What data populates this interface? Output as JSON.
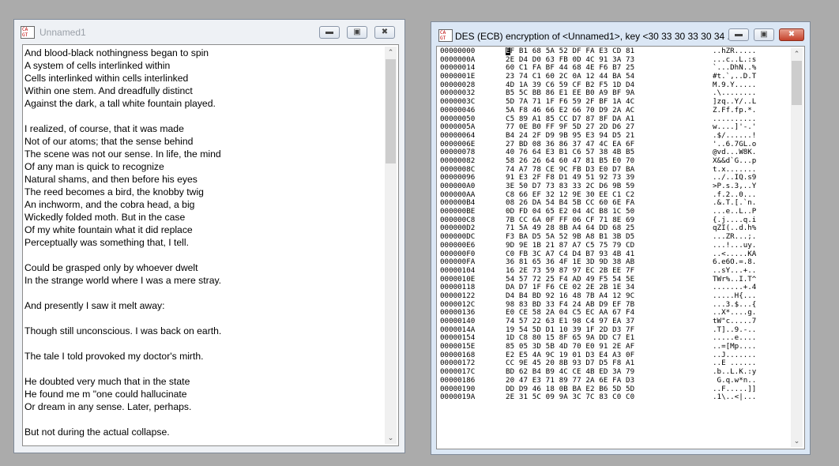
{
  "left_window": {
    "title": "Unnamed1",
    "lines": [
      "And blood-black nothingness began to spin",
      "A system of cells interlinked within",
      "Cells interlinked within cells interlinked",
      "Within one stem. And dreadfully distinct",
      "Against the dark, a tall white fountain played.",
      "",
      "I realized, of course, that it was made",
      "Not of our atoms; that the sense behind",
      "The scene was not our sense. In life, the mind",
      "Of any man is quick to recognize",
      "Natural shams, and then before his eyes",
      "The reed becomes a bird, the knobby twig",
      "An inchworm, and the cobra head, a big",
      "Wickedly folded moth. But in the case",
      "Of my white fountain what it did replace",
      "Perceptually was something that, I tell.",
      "",
      "Could be grasped only by whoever dwelt",
      "In the strange world where I was a mere stray.",
      "",
      "And presently I saw it melt away:",
      "",
      "Though still unconscious. I was back on earth.",
      "",
      "The tale I told provoked my doctor's mirth.",
      "",
      "He doubted very much that in the state",
      "He found me m \"one could hallucinate",
      "Or dream in any sense. Later, perhaps.",
      "",
      "But not during the actual collapse."
    ]
  },
  "right_window": {
    "title": "DES (ECB) encryption of <Unnamed1>, key <30 33 30 33 30 34 ...",
    "rows": [
      {
        "offset": "00000000",
        "bytes": "EF B1 68 5A 52 DF FA E3 CD 81",
        "ascii": "..hZR....."
      },
      {
        "offset": "0000000A",
        "bytes": "2E D4 D0 63 FB 0D 4C 91 3A 73",
        "ascii": "...c..L.:s"
      },
      {
        "offset": "00000014",
        "bytes": "60 C1 FA BF 44 68 4E F6 B7 25",
        "ascii": "`...DhN..%"
      },
      {
        "offset": "0000001E",
        "bytes": "23 74 C1 60 2C 0A 12 44 BA 54",
        "ascii": "#t.`,..D.T"
      },
      {
        "offset": "00000028",
        "bytes": "4D 1A 39 C6 59 CF B2 F5 1D D4",
        "ascii": "M.9.Y....."
      },
      {
        "offset": "00000032",
        "bytes": "B5 5C BB 86 E1 EE B0 A9 BF 9A",
        "ascii": ".\\........"
      },
      {
        "offset": "0000003C",
        "bytes": "5D 7A 71 1F F6 59 2F BF 1A 4C",
        "ascii": "]zq..Y/..L"
      },
      {
        "offset": "00000046",
        "bytes": "5A F8 46 66 E2 66 70 D9 2A AC",
        "ascii": "Z.Ff.fp.*."
      },
      {
        "offset": "00000050",
        "bytes": "C5 89 A1 85 CC D7 87 8F DA A1",
        "ascii": ".........."
      },
      {
        "offset": "0000005A",
        "bytes": "77 0E B0 FF 9F 5D 27 2D D6 27",
        "ascii": "w....]'-.'"
      },
      {
        "offset": "00000064",
        "bytes": "B4 24 2F D9 9B 95 E3 94 D5 21",
        "ascii": ".$/......!"
      },
      {
        "offset": "0000006E",
        "bytes": "27 BD 08 36 86 37 47 4C EA 6F",
        "ascii": "'..6.7GL.o"
      },
      {
        "offset": "00000078",
        "bytes": "40 76 64 E3 B1 C6 57 38 4B B5",
        "ascii": "@vd...W8K."
      },
      {
        "offset": "00000082",
        "bytes": "58 26 26 64 60 47 81 B5 E0 70",
        "ascii": "X&&d`G...p"
      },
      {
        "offset": "0000008C",
        "bytes": "74 A7 78 CE 9C FB D3 E0 D7 BA",
        "ascii": "t.x......."
      },
      {
        "offset": "00000096",
        "bytes": "91 E3 2F F8 D1 49 51 92 73 39",
        "ascii": "../..IQ.s9"
      },
      {
        "offset": "000000A0",
        "bytes": "3E 50 D7 73 83 33 2C D6 9B 59",
        "ascii": ">P.s.3,..Y"
      },
      {
        "offset": "000000AA",
        "bytes": "C8 66 EF 32 12 9E 30 EE C1 C2",
        "ascii": ".f.2..0..."
      },
      {
        "offset": "000000B4",
        "bytes": "08 26 DA 54 B4 5B CC 60 6E FA",
        "ascii": ".&.T.[.`n."
      },
      {
        "offset": "000000BE",
        "bytes": "0D FD 04 65 E2 04 4C B8 1C 50",
        "ascii": "...e..L..P"
      },
      {
        "offset": "000000C8",
        "bytes": "7B CC 6A 0F FF 06 CF 71 8E 69",
        "ascii": "{.j....q.i"
      },
      {
        "offset": "000000D2",
        "bytes": "71 5A 49 28 8B A4 64 DD 68 25",
        "ascii": "qZI(..d.h%"
      },
      {
        "offset": "000000DC",
        "bytes": "F3 BA D5 5A 52 9B A8 B1 3B D5",
        "ascii": "...ZR...;."
      },
      {
        "offset": "000000E6",
        "bytes": "9D 9E 1B 21 87 A7 C5 75 79 CD",
        "ascii": "...!...uy."
      },
      {
        "offset": "000000F0",
        "bytes": "C0 FB 3C A7 C4 D4 B7 93 4B 41",
        "ascii": "..<.....KA"
      },
      {
        "offset": "000000FA",
        "bytes": "36 81 65 36 4F 1E 3D 9D 38 AB",
        "ascii": "6.e6O.=.8."
      },
      {
        "offset": "00000104",
        "bytes": "16 2E 73 59 87 97 EC 2B EE 7F",
        "ascii": "..sY...+.."
      },
      {
        "offset": "0000010E",
        "bytes": "54 57 72 25 F4 AD 49 F5 54 5E",
        "ascii": "TWr%..I.T^"
      },
      {
        "offset": "00000118",
        "bytes": "DA D7 1F F6 CE 02 2E 2B 1E 34",
        "ascii": ".......+.4"
      },
      {
        "offset": "00000122",
        "bytes": "D4 B4 BD 92 16 48 7B A4 12 9C",
        "ascii": ".....H{..."
      },
      {
        "offset": "0000012C",
        "bytes": "98 83 BD 33 F4 24 AB D9 EF 7B",
        "ascii": "...3.$...{"
      },
      {
        "offset": "00000136",
        "bytes": "E0 CE 58 2A 04 C5 EC AA 67 F4",
        "ascii": "..X*....g."
      },
      {
        "offset": "00000140",
        "bytes": "74 57 22 63 E1 98 C4 97 EA 37",
        "ascii": "tW\"c.....7"
      },
      {
        "offset": "0000014A",
        "bytes": "19 54 5D D1 10 39 1F 2D D3 7F",
        "ascii": ".T]..9.-.."
      },
      {
        "offset": "00000154",
        "bytes": "1D C8 80 15 8F 65 9A DD C7 E1",
        "ascii": ".....e...."
      },
      {
        "offset": "0000015E",
        "bytes": "85 05 3D 5B 4D 70 E0 91 2E AF",
        "ascii": "..=[Mp...."
      },
      {
        "offset": "00000168",
        "bytes": "E2 E5 4A 9C 19 01 D3 E4 A3 0F",
        "ascii": "..J......."
      },
      {
        "offset": "00000172",
        "bytes": "CC 9E 45 20 8B 93 D7 D5 F8 A1",
        "ascii": "..E ......"
      },
      {
        "offset": "0000017C",
        "bytes": "BD 62 B4 B9 4C CE 4B ED 3A 79",
        "ascii": ".b..L.K.:y"
      },
      {
        "offset": "00000186",
        "bytes": "20 47 E3 71 89 77 2A 6E FA D3",
        "ascii": " G.q.w*n.."
      },
      {
        "offset": "00000190",
        "bytes": "DD D9 46 18 0B BA E2 B6 5D 5D",
        "ascii": "..F.....]]"
      },
      {
        "offset": "0000019A",
        "bytes": "2E 31 5C 09 9A 3C 7C 83 C0 C0",
        "ascii": ".1\\..<|..."
      }
    ]
  }
}
